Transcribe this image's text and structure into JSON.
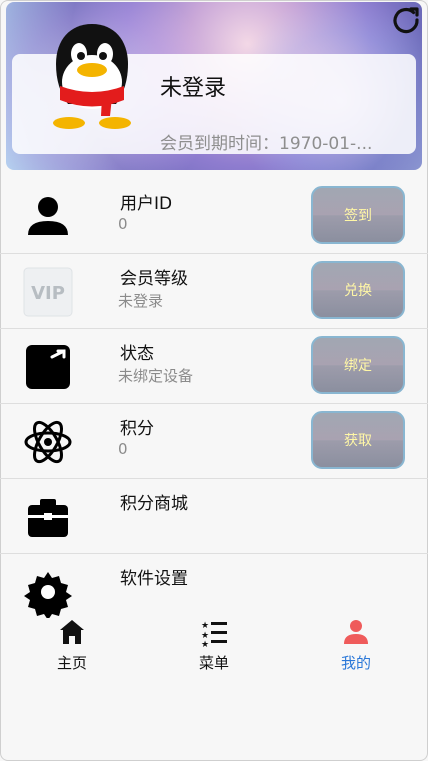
{
  "profile": {
    "name": "未登录",
    "expiry": "会员到期时间：1970-01-..."
  },
  "rows": [
    {
      "title": "用户ID",
      "sub": "0",
      "button": "签到",
      "icon": "user-icon"
    },
    {
      "title": "会员等级",
      "sub": "未登录",
      "button": "兑换",
      "icon": "vip-icon"
    },
    {
      "title": "状态",
      "sub": "未绑定设备",
      "button": "绑定",
      "icon": "state-box-icon"
    },
    {
      "title": "积分",
      "sub": "0",
      "button": "获取",
      "icon": "atom-icon"
    },
    {
      "title": "积分商城",
      "sub": "",
      "button": "",
      "icon": "toolbox-icon"
    },
    {
      "title": "软件设置",
      "sub": "",
      "button": "",
      "icon": "gear-icon"
    }
  ],
  "nav": {
    "home": "主页",
    "menu": "菜单",
    "mine": "我的"
  },
  "colors": {
    "nav_active": "#2b78d8",
    "button_text": "#fff7a6",
    "accent_gray": "#8b8b8b"
  }
}
